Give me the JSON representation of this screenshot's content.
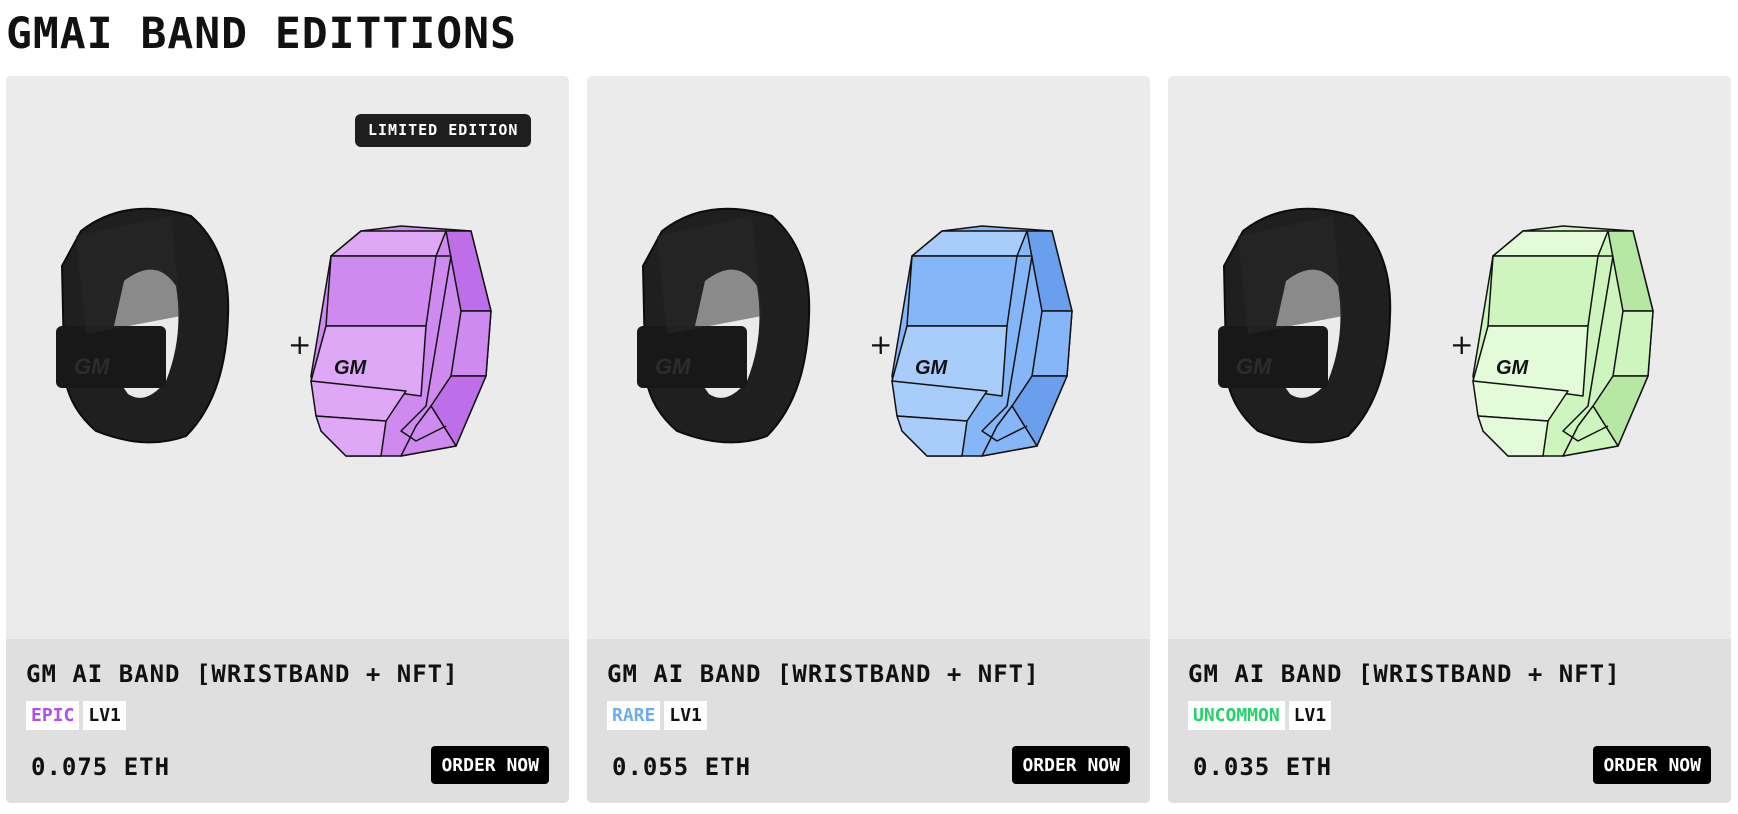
{
  "page": {
    "title": "GMAI BAND EDITTIONS"
  },
  "cards": [
    {
      "badge": "LIMITED EDITION",
      "name": "GM AI BAND [WRISTBAND + NFT]",
      "rarity": "EPIC",
      "rarity_color": "#b04cf0",
      "level": "LV1",
      "price": "0.075 ETH",
      "order_label": "ORDER NOW",
      "plus": "+",
      "logo": "GM",
      "nft_colors": {
        "light": "#dea8f7",
        "mid": "#cf8af0",
        "dark": "#bd6ee8"
      }
    },
    {
      "badge": "",
      "name": "GM AI BAND [WRISTBAND + NFT]",
      "rarity": "RARE",
      "rarity_color": "#6aaef0",
      "level": "LV1",
      "price": "0.055 ETH",
      "order_label": "ORDER NOW",
      "plus": "+",
      "logo": "GM",
      "nft_colors": {
        "light": "#a9cdfb",
        "mid": "#85b6f8",
        "dark": "#6a9fee"
      }
    },
    {
      "badge": "",
      "name": "GM AI BAND [WRISTBAND + NFT]",
      "rarity": "UNCOMMON",
      "rarity_color": "#22d36a",
      "level": "LV1",
      "price": "0.035 ETH",
      "order_label": "ORDER NOW",
      "plus": "+",
      "logo": "GM",
      "nft_colors": {
        "light": "#e3fbd8",
        "mid": "#cdf5bd",
        "dark": "#b6e8a4"
      }
    }
  ]
}
